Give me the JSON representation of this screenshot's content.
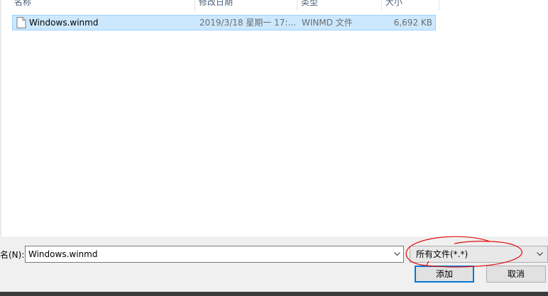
{
  "columns": {
    "name": "名称",
    "date": "修改日期",
    "type": "类型",
    "size": "大小"
  },
  "files": [
    {
      "name": "Windows.winmd",
      "date": "2019/3/18 星期一 17:...",
      "type": "WINMD 文件",
      "size": "6,692 KB",
      "icon": "file-icon",
      "selected": true
    }
  ],
  "footer": {
    "filename_label": "名(N):",
    "filename_value": "Windows.winmd",
    "filter_value": "所有文件(*.*)",
    "add_label": "添加",
    "cancel_label": "取消"
  },
  "colors": {
    "selection_bg": "#cce8ff",
    "selection_border": "#99d1ff",
    "annotation_red": "#e01010",
    "primary_border": "#0078d7"
  }
}
